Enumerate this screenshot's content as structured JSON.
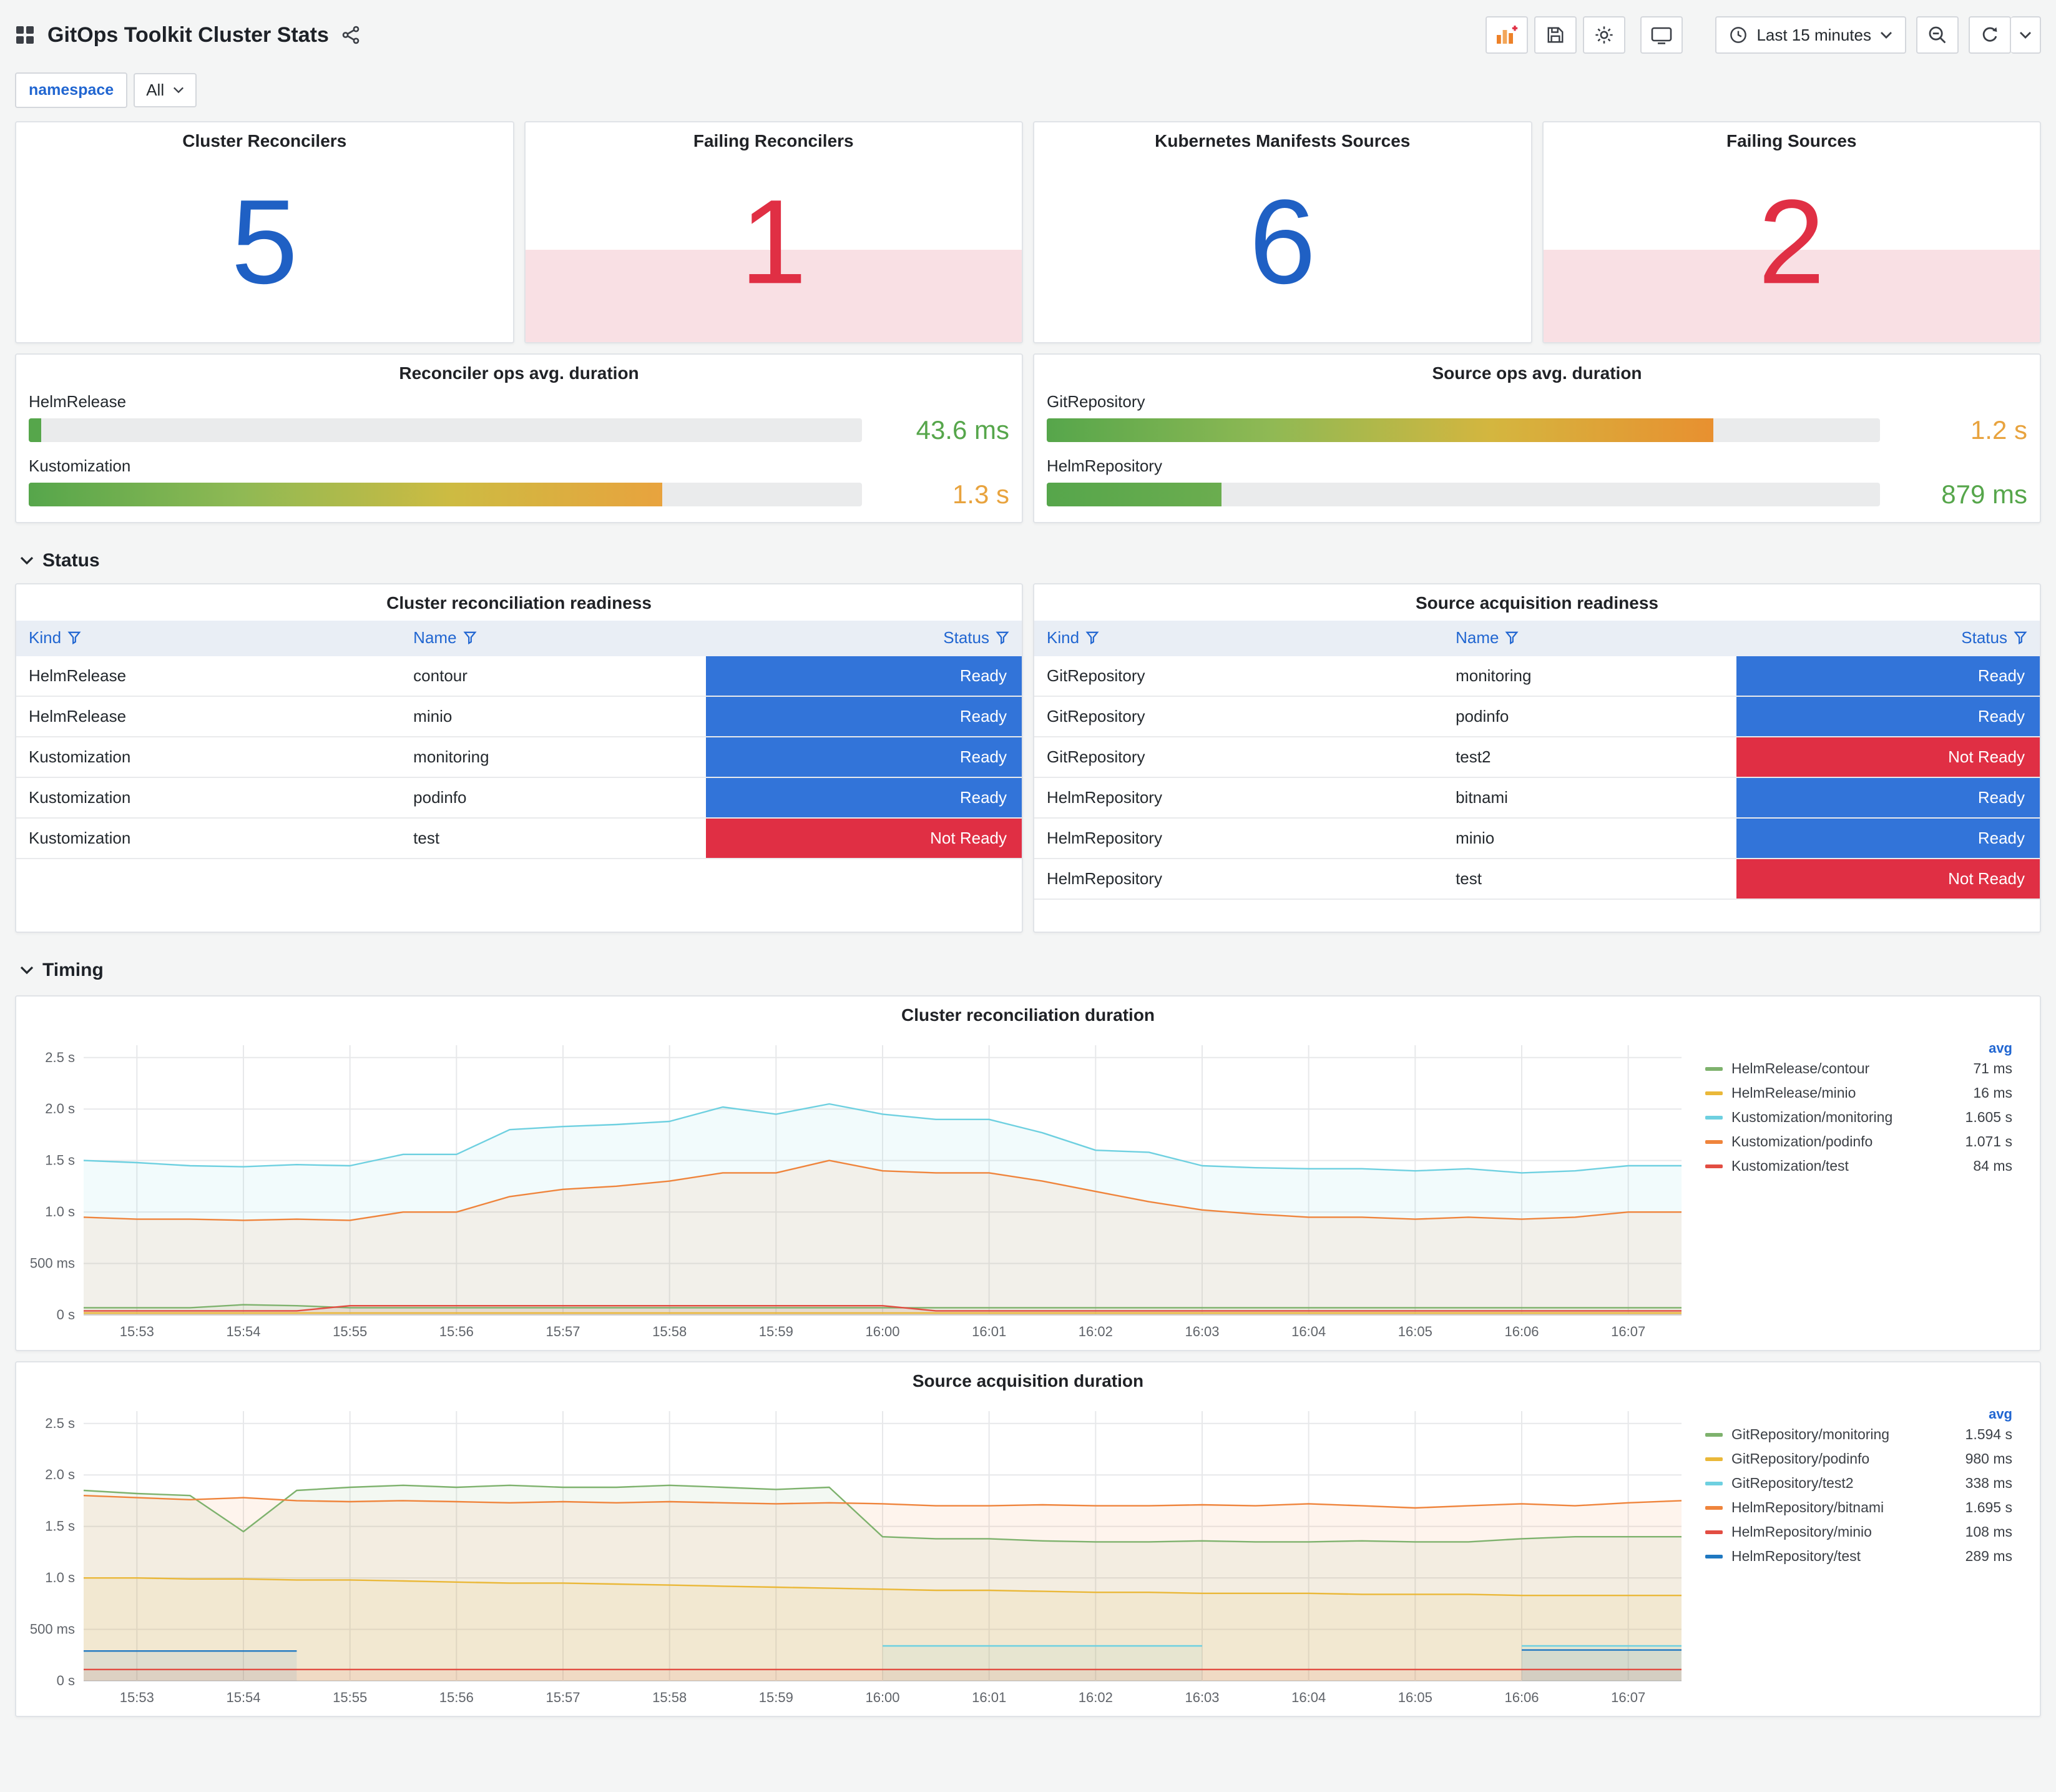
{
  "header": {
    "title": "GitOps Toolkit Cluster Stats",
    "time_range": "Last 15 minutes"
  },
  "variables": {
    "label": "namespace",
    "value": "All"
  },
  "sections": {
    "status": "Status",
    "timing": "Timing"
  },
  "palette": {
    "stat_blue": "#1F60C4",
    "stat_red": "#E02F44",
    "stat_red_background": "#F9E0E4",
    "link_blue": "#2166D1",
    "green_value": "#56A64B",
    "orange_value": "#E8A33E"
  },
  "status_colors": {
    "Ready": "#3274D9",
    "Not Ready": "#E02F44"
  },
  "stats": [
    {
      "title": "Cluster Reconcilers",
      "value": "5",
      "value_color": "#1F60C4"
    },
    {
      "title": "Failing Reconcilers",
      "value": "1",
      "value_color": "#E02F44",
      "fill_background": "#F9E0E4"
    },
    {
      "title": "Kubernetes Manifests Sources",
      "value": "6",
      "value_color": "#1F60C4"
    },
    {
      "title": "Failing Sources",
      "value": "2",
      "value_color": "#E02F44",
      "fill_background": "#F9E0E4"
    }
  ],
  "gauges": [
    {
      "title": "Reconciler ops avg. duration",
      "rows": [
        {
          "label": "HelmRelease",
          "value": "43.6 ms",
          "value_color": "#56A64B",
          "percent": 1.5,
          "bar_gradient": [
            "#56A64B",
            "#56A64B"
          ]
        },
        {
          "label": "Kustomization",
          "value": "1.3 s",
          "value_color": "#E8A33E",
          "percent": 76,
          "bar_gradient": [
            "#56A64B",
            "#8FB954",
            "#CDBB42",
            "#E8A33E"
          ]
        }
      ]
    },
    {
      "title": "Source ops avg. duration",
      "rows": [
        {
          "label": "GitRepository",
          "value": "1.2 s",
          "value_color": "#E8A33E",
          "percent": 80,
          "bar_gradient": [
            "#56A64B",
            "#8FB954",
            "#D4B63F",
            "#E89030"
          ]
        },
        {
          "label": "HelmRepository",
          "value": "879 ms",
          "value_color": "#56A64B",
          "percent": 21,
          "bar_gradient": [
            "#56A64B",
            "#6BAD4F"
          ]
        }
      ]
    }
  ],
  "tables": [
    {
      "title": "Cluster reconciliation readiness",
      "columns": [
        "Kind",
        "Name",
        "Status"
      ],
      "rows": [
        {
          "kind": "HelmRelease",
          "name": "contour",
          "status": "Ready"
        },
        {
          "kind": "HelmRelease",
          "name": "minio",
          "status": "Ready"
        },
        {
          "kind": "Kustomization",
          "name": "monitoring",
          "status": "Ready"
        },
        {
          "kind": "Kustomization",
          "name": "podinfo",
          "status": "Ready"
        },
        {
          "kind": "Kustomization",
          "name": "test",
          "status": "Not Ready"
        }
      ]
    },
    {
      "title": "Source acquisition readiness",
      "columns": [
        "Kind",
        "Name",
        "Status"
      ],
      "rows": [
        {
          "kind": "GitRepository",
          "name": "monitoring",
          "status": "Ready"
        },
        {
          "kind": "GitRepository",
          "name": "podinfo",
          "status": "Ready"
        },
        {
          "kind": "GitRepository",
          "name": "test2",
          "status": "Not Ready"
        },
        {
          "kind": "HelmRepository",
          "name": "bitnami",
          "status": "Ready"
        },
        {
          "kind": "HelmRepository",
          "name": "minio",
          "status": "Ready"
        },
        {
          "kind": "HelmRepository",
          "name": "test",
          "status": "Not Ready"
        }
      ]
    }
  ],
  "chart_data": [
    {
      "type": "line",
      "title": "Cluster reconciliation duration",
      "unit": "seconds",
      "x_start": "15:52:30",
      "x_step_seconds": 30,
      "x_tick_labels": [
        "15:53",
        "15:54",
        "15:55",
        "15:56",
        "15:57",
        "15:58",
        "15:59",
        "16:00",
        "16:01",
        "16:02",
        "16:03",
        "16:04",
        "16:05",
        "16:06",
        "16:07"
      ],
      "x_tick_first_index": 1,
      "x_tick_index_step": 2,
      "y_ticks": [
        {
          "value": 0,
          "label": "0 s"
        },
        {
          "value": 0.5,
          "label": "500 ms"
        },
        {
          "value": 1.0,
          "label": "1.0 s"
        },
        {
          "value": 1.5,
          "label": "1.5 s"
        },
        {
          "value": 2.0,
          "label": "2.0 s"
        },
        {
          "value": 2.5,
          "label": "2.5 s"
        }
      ],
      "y_max": 2.62,
      "legend_value_header": "avg",
      "legend_position": "right",
      "grid": true,
      "series": [
        {
          "name": "HelmRelease/contour",
          "color": "#7EB26D",
          "avg": "71 ms",
          "values": [
            0.07,
            0.07,
            0.07,
            0.1,
            0.09,
            0.07,
            0.07,
            0.07,
            0.07,
            0.07,
            0.07,
            0.07,
            0.07,
            0.07,
            0.07,
            0.07,
            0.07,
            0.07,
            0.07,
            0.07,
            0.07,
            0.07,
            0.07,
            0.07,
            0.07,
            0.07,
            0.07,
            0.07,
            0.07,
            0.07,
            0.07
          ]
        },
        {
          "name": "HelmRelease/minio",
          "color": "#EAB839",
          "avg": "16 ms",
          "values": [
            0.02,
            0.02,
            0.02,
            0.02,
            0.02,
            0.02,
            0.02,
            0.02,
            0.02,
            0.02,
            0.02,
            0.02,
            0.02,
            0.02,
            0.02,
            0.02,
            0.02,
            0.02,
            0.02,
            0.02,
            0.02,
            0.02,
            0.02,
            0.02,
            0.02,
            0.02,
            0.02,
            0.02,
            0.02,
            0.02,
            0.02
          ]
        },
        {
          "name": "Kustomization/monitoring",
          "color": "#6ED0E0",
          "avg": "1.605 s",
          "values": [
            1.5,
            1.48,
            1.45,
            1.44,
            1.46,
            1.45,
            1.56,
            1.56,
            1.8,
            1.83,
            1.85,
            1.88,
            2.02,
            1.95,
            2.05,
            1.95,
            1.9,
            1.9,
            1.77,
            1.6,
            1.58,
            1.45,
            1.43,
            1.42,
            1.42,
            1.4,
            1.42,
            1.38,
            1.4,
            1.45,
            1.45
          ]
        },
        {
          "name": "Kustomization/podinfo",
          "color": "#EF843C",
          "avg": "1.071 s",
          "values": [
            0.95,
            0.93,
            0.93,
            0.92,
            0.93,
            0.92,
            1.0,
            1.0,
            1.15,
            1.22,
            1.25,
            1.3,
            1.38,
            1.38,
            1.5,
            1.4,
            1.38,
            1.38,
            1.3,
            1.2,
            1.1,
            1.02,
            0.98,
            0.95,
            0.95,
            0.93,
            0.95,
            0.93,
            0.95,
            1.0,
            1.0
          ]
        },
        {
          "name": "Kustomization/test",
          "color": "#E24D42",
          "avg": "84 ms",
          "values": [
            0.04,
            0.04,
            0.04,
            0.04,
            0.04,
            0.09,
            0.09,
            0.09,
            0.09,
            0.09,
            0.09,
            0.09,
            0.09,
            0.09,
            0.09,
            0.09,
            0.04,
            0.04,
            0.04,
            0.04,
            0.04,
            0.04,
            0.04,
            0.04,
            0.04,
            0.04,
            0.04,
            0.04,
            0.04,
            0.04,
            0.04
          ]
        }
      ]
    },
    {
      "type": "line",
      "title": "Source acquisition duration",
      "unit": "seconds",
      "x_start": "15:52:30",
      "x_step_seconds": 30,
      "x_tick_labels": [
        "15:53",
        "15:54",
        "15:55",
        "15:56",
        "15:57",
        "15:58",
        "15:59",
        "16:00",
        "16:01",
        "16:02",
        "16:03",
        "16:04",
        "16:05",
        "16:06",
        "16:07"
      ],
      "x_tick_first_index": 1,
      "x_tick_index_step": 2,
      "y_ticks": [
        {
          "value": 0,
          "label": "0 s"
        },
        {
          "value": 0.5,
          "label": "500 ms"
        },
        {
          "value": 1.0,
          "label": "1.0 s"
        },
        {
          "value": 1.5,
          "label": "1.5 s"
        },
        {
          "value": 2.0,
          "label": "2.0 s"
        },
        {
          "value": 2.5,
          "label": "2.5 s"
        }
      ],
      "y_max": 2.62,
      "legend_value_header": "avg",
      "legend_position": "right",
      "grid": true,
      "series": [
        {
          "name": "GitRepository/monitoring",
          "color": "#7EB26D",
          "avg": "1.594 s",
          "values": [
            1.85,
            1.82,
            1.8,
            1.45,
            1.85,
            1.88,
            1.9,
            1.88,
            1.9,
            1.88,
            1.88,
            1.9,
            1.88,
            1.86,
            1.88,
            1.4,
            1.38,
            1.38,
            1.36,
            1.35,
            1.35,
            1.36,
            1.35,
            1.35,
            1.36,
            1.35,
            1.35,
            1.38,
            1.4,
            1.4,
            1.4
          ]
        },
        {
          "name": "GitRepository/podinfo",
          "color": "#EAB839",
          "avg": "980 ms",
          "values": [
            1.0,
            1.0,
            0.99,
            0.99,
            0.98,
            0.98,
            0.97,
            0.96,
            0.95,
            0.95,
            0.94,
            0.93,
            0.92,
            0.91,
            0.9,
            0.89,
            0.88,
            0.88,
            0.87,
            0.86,
            0.86,
            0.85,
            0.85,
            0.85,
            0.84,
            0.84,
            0.84,
            0.83,
            0.83,
            0.83,
            0.83
          ]
        },
        {
          "name": "GitRepository/test2",
          "color": "#6ED0E0",
          "avg": "338 ms",
          "values": [
            null,
            null,
            null,
            null,
            null,
            null,
            null,
            null,
            null,
            null,
            null,
            null,
            null,
            null,
            null,
            0.34,
            0.34,
            0.34,
            0.34,
            0.34,
            0.34,
            0.34,
            null,
            null,
            null,
            null,
            null,
            0.34,
            0.34,
            0.34,
            0.34
          ]
        },
        {
          "name": "HelmRepository/bitnami",
          "color": "#EF843C",
          "avg": "1.695 s",
          "values": [
            1.8,
            1.78,
            1.76,
            1.78,
            1.75,
            1.74,
            1.75,
            1.74,
            1.73,
            1.74,
            1.73,
            1.74,
            1.73,
            1.72,
            1.73,
            1.72,
            1.7,
            1.7,
            1.71,
            1.7,
            1.7,
            1.71,
            1.7,
            1.72,
            1.7,
            1.68,
            1.7,
            1.72,
            1.7,
            1.73,
            1.75
          ]
        },
        {
          "name": "HelmRepository/minio",
          "color": "#E24D42",
          "avg": "108 ms",
          "values": [
            0.11,
            0.11,
            0.11,
            0.11,
            0.11,
            0.11,
            0.11,
            0.11,
            0.11,
            0.11,
            0.11,
            0.11,
            0.11,
            0.11,
            0.11,
            0.11,
            0.11,
            0.11,
            0.11,
            0.11,
            0.11,
            0.11,
            0.11,
            0.11,
            0.11,
            0.11,
            0.11,
            0.11,
            0.11,
            0.11,
            0.11
          ]
        },
        {
          "name": "HelmRepository/test",
          "color": "#1F78C1",
          "avg": "289 ms",
          "values": [
            0.29,
            0.29,
            0.29,
            0.29,
            0.29,
            null,
            null,
            null,
            null,
            null,
            null,
            null,
            null,
            null,
            null,
            null,
            null,
            null,
            null,
            null,
            null,
            null,
            null,
            null,
            null,
            null,
            null,
            0.3,
            0.3,
            0.3,
            0.3
          ]
        }
      ]
    }
  ]
}
